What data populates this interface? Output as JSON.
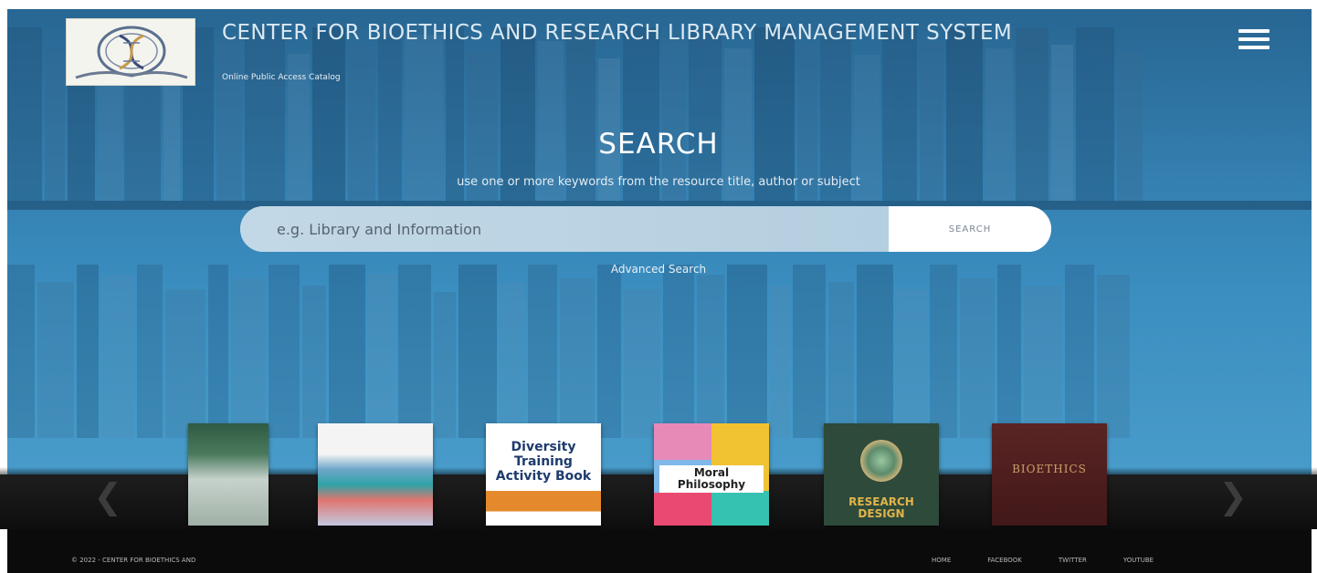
{
  "header": {
    "title": "CENTER FOR BIOETHICS AND RESEARCH LIBRARY MANAGEMENT SYSTEM",
    "subtitle": "Online Public Access Catalog",
    "logo_icon": "dna-helix-seal-icon",
    "menu_icon": "hamburger-menu-icon"
  },
  "search": {
    "heading": "SEARCH",
    "hint": "use one or more keywords from the resource title, author or subject",
    "placeholder": "e.g. Library and Information",
    "button_label": "SEARCH",
    "advanced_link": "Advanced Search"
  },
  "carousel": {
    "prev_icon": "chevron-left-icon",
    "next_icon": "chevron-right-icon",
    "books": [
      {
        "title": "",
        "cover_color": "#3f6a4e"
      },
      {
        "title": "",
        "cover_color": "#f4f4f4"
      },
      {
        "title": "Diversity Training Activity Book",
        "cover_color": "#ffffff"
      },
      {
        "title": "Moral Philosophy",
        "cover_color": "#f1c232"
      },
      {
        "title": "RESEARCH DESIGN",
        "cover_color": "#2e4a3a"
      },
      {
        "title": "BIOETHICS",
        "cover_color": "#4a1f1f"
      }
    ]
  },
  "footer": {
    "copyright": "© 2022 - CENTER FOR BIOETHICS AND",
    "nav": [
      "HOME",
      "FACEBOOK",
      "TWITTER",
      "YOUTUBE"
    ]
  },
  "colors": {
    "hero_blue": "#3a86b4",
    "search_button_bg": "#ffffff",
    "footer_bg": "#0b0b0b"
  }
}
